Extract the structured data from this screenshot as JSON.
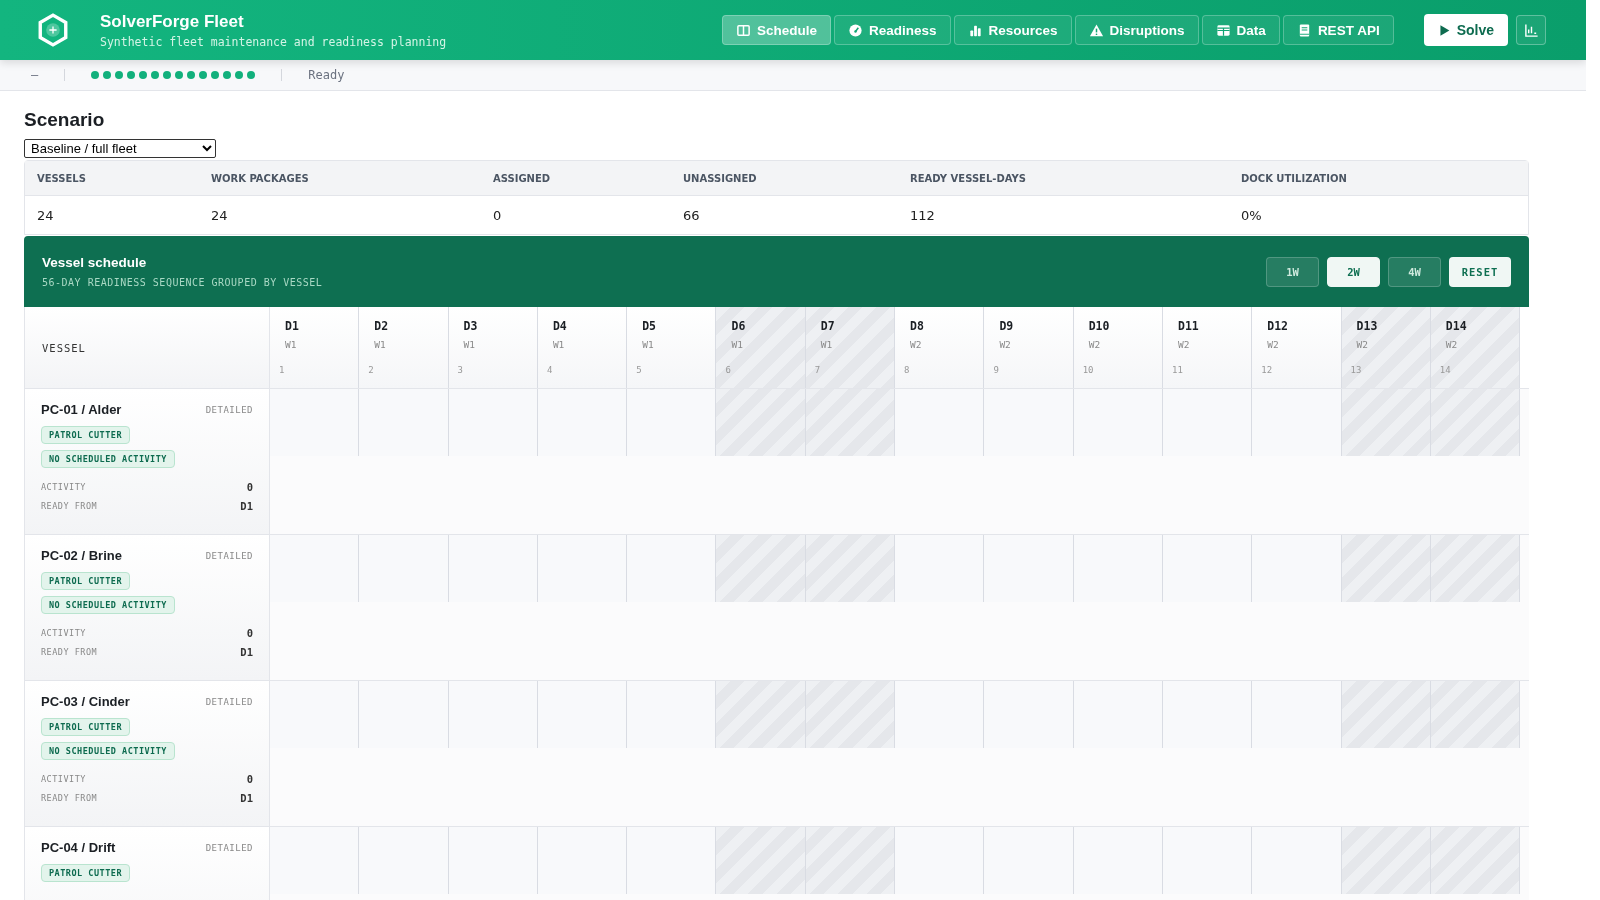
{
  "app": {
    "title": "SolverForge Fleet",
    "subtitle": "Synthetic fleet maintenance and readiness planning"
  },
  "nav": [
    {
      "label": "Schedule",
      "selected": true
    },
    {
      "label": "Readiness",
      "selected": false
    },
    {
      "label": "Resources",
      "selected": false
    },
    {
      "label": "Disruptions",
      "selected": false
    },
    {
      "label": "Data",
      "selected": false
    },
    {
      "label": "REST API",
      "selected": false
    }
  ],
  "solve_button": "Solve",
  "status_bar": {
    "score": "–",
    "progress_dots": [
      {
        "on": true
      },
      {
        "on": true
      },
      {
        "on": true
      },
      {
        "on": true
      },
      {
        "on": true
      },
      {
        "on": true
      },
      {
        "on": true
      },
      {
        "on": true
      },
      {
        "on": true
      },
      {
        "on": true
      },
      {
        "on": true
      },
      {
        "on": true
      },
      {
        "on": true
      },
      {
        "on": true
      }
    ],
    "state": "Ready"
  },
  "scenario": {
    "heading": "Scenario",
    "value": "Baseline / full fleet"
  },
  "metrics": [
    {
      "label": "VESSELS",
      "value": "24"
    },
    {
      "label": "WORK PACKAGES",
      "value": "24"
    },
    {
      "label": "ASSIGNED",
      "value": "0"
    },
    {
      "label": "UNASSIGNED",
      "value": "66"
    },
    {
      "label": "READY VESSEL-DAYS",
      "value": "112"
    },
    {
      "label": "DOCK UTILIZATION",
      "value": "0%"
    }
  ],
  "schedule": {
    "title": "Vessel schedule",
    "subtitle": "56-DAY READINESS SEQUENCE GROUPED BY VESSEL",
    "zoom_buttons": [
      {
        "label": "1W",
        "selected": false
      },
      {
        "label": "2W",
        "selected": true
      },
      {
        "label": "4W",
        "selected": false
      }
    ],
    "reset_button": "RESET",
    "vessel_header": "VESSEL",
    "days": [
      {
        "day": "D1",
        "week": "W1",
        "index": "1",
        "weekend": false
      },
      {
        "day": "D2",
        "week": "W1",
        "index": "2",
        "weekend": false
      },
      {
        "day": "D3",
        "week": "W1",
        "index": "3",
        "weekend": false
      },
      {
        "day": "D4",
        "week": "W1",
        "index": "4",
        "weekend": false
      },
      {
        "day": "D5",
        "week": "W1",
        "index": "5",
        "weekend": false
      },
      {
        "day": "D6",
        "week": "W1",
        "index": "6",
        "weekend": true
      },
      {
        "day": "D7",
        "week": "W1",
        "index": "7",
        "weekend": true
      },
      {
        "day": "D8",
        "week": "W2",
        "index": "8",
        "weekend": false
      },
      {
        "day": "D9",
        "week": "W2",
        "index": "9",
        "weekend": false
      },
      {
        "day": "D10",
        "week": "W2",
        "index": "10",
        "weekend": false
      },
      {
        "day": "D11",
        "week": "W2",
        "index": "11",
        "weekend": false
      },
      {
        "day": "D12",
        "week": "W2",
        "index": "12",
        "weekend": false
      },
      {
        "day": "D13",
        "week": "W2",
        "index": "13",
        "weekend": true
      },
      {
        "day": "D14",
        "week": "W2",
        "index": "14",
        "weekend": true
      }
    ],
    "vessels": [
      {
        "name": "PC-01 / Alder",
        "mode": "DETAILED",
        "tags": [
          "PATROL CUTTER",
          "NO SCHEDULED ACTIVITY"
        ],
        "stats": [
          {
            "label": "ACTIVITY",
            "value": "0"
          },
          {
            "label": "READY FROM",
            "value": "D1"
          }
        ]
      },
      {
        "name": "PC-02 / Brine",
        "mode": "DETAILED",
        "tags": [
          "PATROL CUTTER",
          "NO SCHEDULED ACTIVITY"
        ],
        "stats": [
          {
            "label": "ACTIVITY",
            "value": "0"
          },
          {
            "label": "READY FROM",
            "value": "D1"
          }
        ]
      },
      {
        "name": "PC-03 / Cinder",
        "mode": "DETAILED",
        "tags": [
          "PATROL CUTTER",
          "NO SCHEDULED ACTIVITY"
        ],
        "stats": [
          {
            "label": "ACTIVITY",
            "value": "0"
          },
          {
            "label": "READY FROM",
            "value": "D1"
          }
        ]
      },
      {
        "name": "PC-04 / Drift",
        "mode": "DETAILED",
        "tags": [
          "PATROL CUTTER"
        ]
      }
    ]
  }
}
